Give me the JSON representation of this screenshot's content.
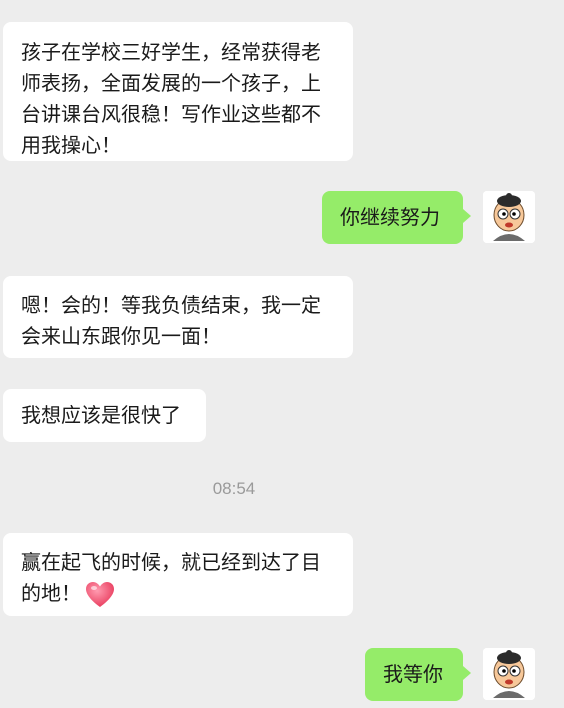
{
  "messages": [
    {
      "side": "left",
      "text": "孩子在学校三好学生，经常获得老师表扬，全面发展的一个孩子，上台讲课台风很稳！写作业这些都不用我操心！"
    },
    {
      "side": "right",
      "text": "你继续努力"
    },
    {
      "side": "left",
      "text": "嗯！会的！等我负债结束，我一定会来山东跟你见一面！"
    },
    {
      "side": "left",
      "text": "我想应该是很快了"
    },
    {
      "side": "left",
      "text": "赢在起飞的时候，就已经到达了目的地！",
      "emoji": "heart-icon"
    },
    {
      "side": "right",
      "text": "我等你"
    }
  ],
  "timestamp": "08:54",
  "colors": {
    "background": "#ededed",
    "incoming_bubble": "#ffffff",
    "outgoing_bubble": "#95ec69",
    "timestamp": "#9a9a9a"
  },
  "avatar_icon": "cartoon-boy-avatar"
}
